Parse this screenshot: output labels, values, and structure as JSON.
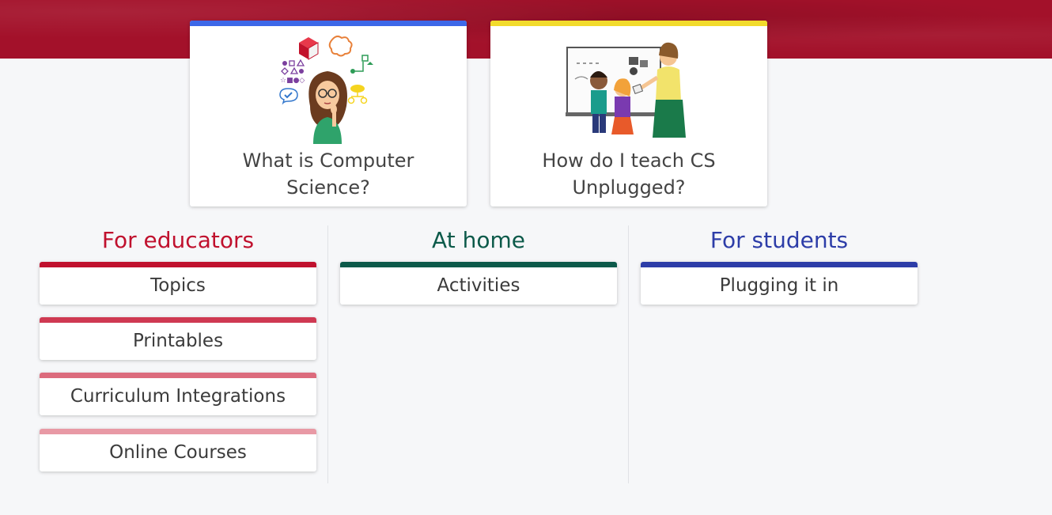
{
  "feature_cards": [
    {
      "title": "What is Computer Science?",
      "accent": "#3d68e8"
    },
    {
      "title": "How do I teach CS Unplugged?",
      "accent": "#f2db2c"
    }
  ],
  "columns": [
    {
      "heading": "For educators",
      "heading_color": "#c0112e",
      "links": [
        {
          "label": "Topics",
          "accent": "#c0112e"
        },
        {
          "label": "Printables",
          "accent": "#cf3952"
        },
        {
          "label": "Curriculum Integrations",
          "accent": "#dc6a7c"
        },
        {
          "label": "Online Courses",
          "accent": "#e899a5"
        }
      ]
    },
    {
      "heading": "At home",
      "heading_color": "#0c5a4a",
      "links": [
        {
          "label": "Activities",
          "accent": "#0c5a4a"
        }
      ]
    },
    {
      "heading": "For students",
      "heading_color": "#2d3da8",
      "links": [
        {
          "label": "Plugging it in",
          "accent": "#2d3da8"
        }
      ]
    }
  ],
  "colors": {
    "banner": "#a3112a",
    "background": "#f6f7f9"
  }
}
